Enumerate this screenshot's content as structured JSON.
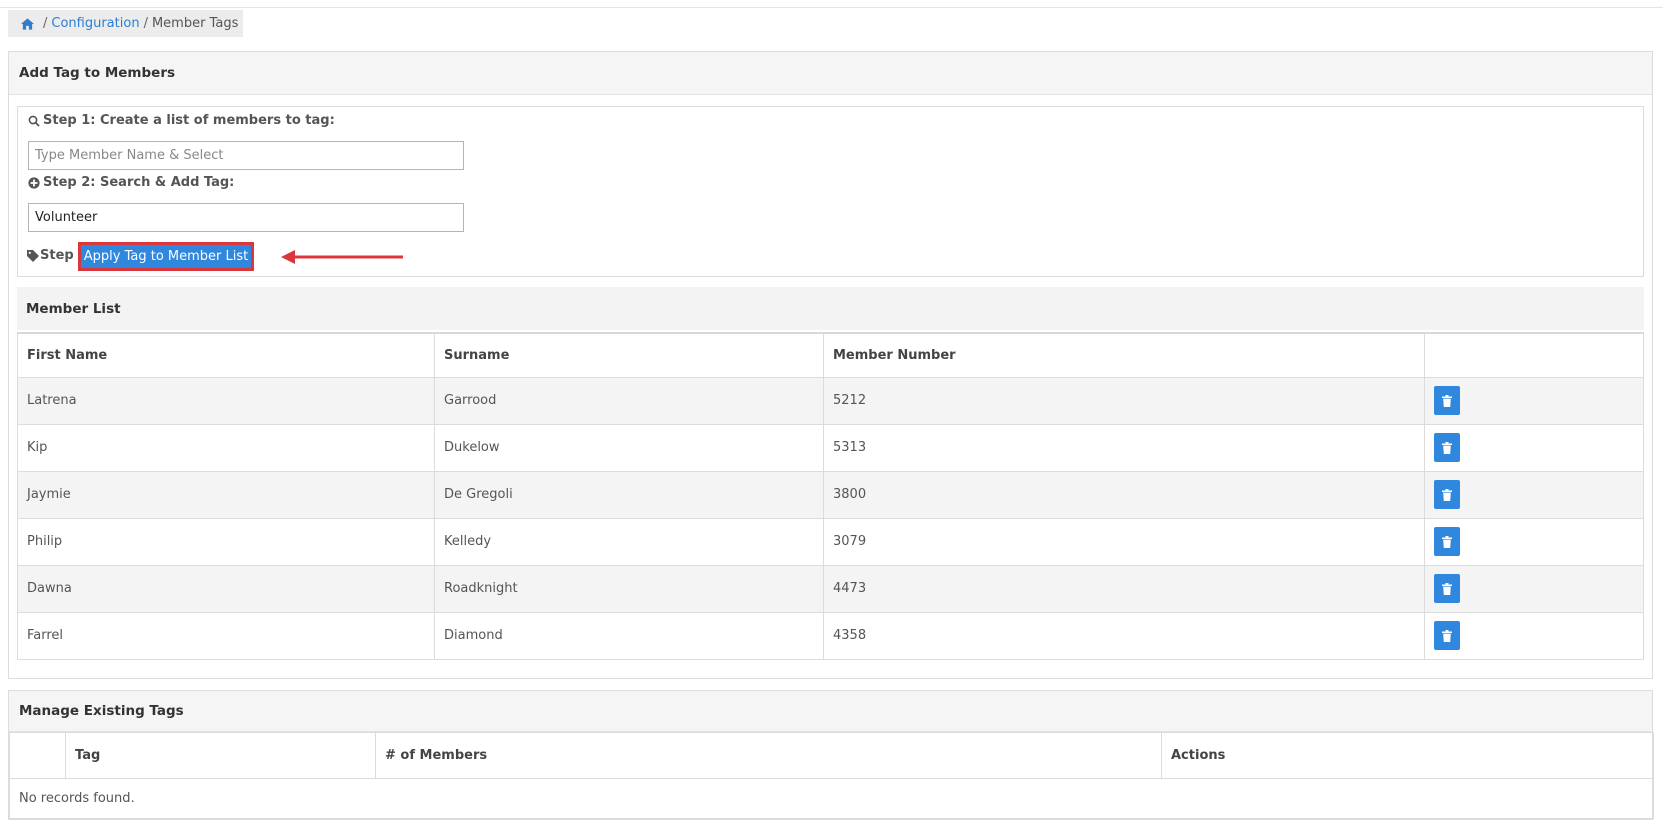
{
  "breadcrumb": {
    "home_icon": "home-icon",
    "link": "Configuration",
    "separator": "/",
    "current": "Member Tags"
  },
  "add_panel": {
    "title": "Add Tag to Members",
    "step1_label": "Step 1: Create a list of members to tag:",
    "step1_placeholder": "Type Member Name & Select",
    "step2_label": "Step 2: Search & Add Tag:",
    "step2_value": "Volunteer",
    "step3_label": "Step 3:",
    "apply_button": "Apply Tag to Member List"
  },
  "member_list": {
    "title": "Member List",
    "columns": [
      "First Name",
      "Surname",
      "Member Number",
      ""
    ],
    "rows": [
      {
        "first": "Latrena",
        "surname": "Garrood",
        "number": "5212"
      },
      {
        "first": "Kip",
        "surname": "Dukelow",
        "number": "5313"
      },
      {
        "first": "Jaymie",
        "surname": "De Gregoli",
        "number": "3800"
      },
      {
        "first": "Philip",
        "surname": "Kelledy",
        "number": "3079"
      },
      {
        "first": "Dawna",
        "surname": "Roadknight",
        "number": "4473"
      },
      {
        "first": "Farrel",
        "surname": "Diamond",
        "number": "4358"
      }
    ]
  },
  "manage_panel": {
    "title": "Manage Existing Tags",
    "columns": [
      "",
      "Tag",
      "# of Members",
      "Actions"
    ],
    "empty_text": "No records found."
  },
  "colors": {
    "primary": "#2f87de",
    "highlight": "#d9363e",
    "link": "#2a7fd4"
  }
}
